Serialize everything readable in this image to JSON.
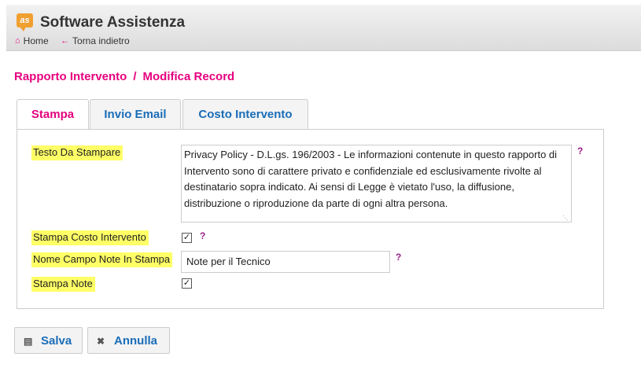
{
  "app": {
    "logo_text": "as",
    "title": "Software Assistenza",
    "nav": [
      {
        "icon": "home-icon",
        "glyph": "🏠",
        "label": "Home"
      },
      {
        "icon": "back-arrow-icon",
        "glyph": "⇐",
        "label": "Torna indietro"
      }
    ]
  },
  "breadcrumb": {
    "section": "Rapporto Intervento",
    "separator": "/",
    "page": "Modifica Record"
  },
  "tabs": [
    {
      "label": "Stampa",
      "active": true
    },
    {
      "label": "Invio Email",
      "active": false
    },
    {
      "label": "Costo Intervento",
      "active": false
    }
  ],
  "form": {
    "testo_label": "Testo Da Stampare",
    "testo_value": "Privacy Policy - D.L.gs. 196/2003 - Le informazioni contenute in questo rapporto di Intervento sono di carattere privato e confidenziale ed esclusivamente rivolte al destinatario sopra indicato. Ai sensi di Legge è vietato l'uso, la diffusione, distribuzione o riproduzione da parte di ogni altra persona.",
    "stampa_costo_label": "Stampa Costo Intervento",
    "stampa_costo_checked": true,
    "nome_campo_label": "Nome Campo Note In Stampa",
    "nome_campo_value": "Note per il Tecnico",
    "stampa_note_label": "Stampa Note",
    "stampa_note_checked": true,
    "help": "?"
  },
  "buttons": {
    "save": {
      "icon": "save-icon",
      "label": "Salva"
    },
    "cancel": {
      "icon": "close-icon",
      "label": "Annulla"
    }
  },
  "colors": {
    "accent": "#e6007e",
    "link": "#1a6db8",
    "highlight": "#ffff66",
    "help": "#9b1f8c"
  }
}
